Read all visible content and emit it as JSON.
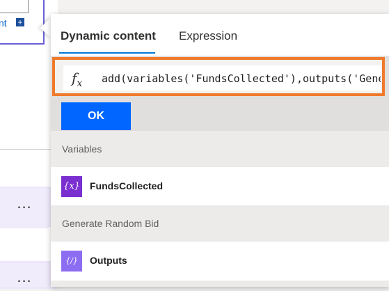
{
  "background": {
    "add_link_text": "nt",
    "plus_icon": "plus-icon",
    "ellipsis_1": "...",
    "ellipsis_2": "..."
  },
  "panel": {
    "tabs": [
      {
        "label": "Dynamic content",
        "active": true
      },
      {
        "label": "Expression",
        "active": false
      }
    ],
    "expression": {
      "fx_label": "f",
      "fx_sub": "x",
      "value": "add(variables('FundsCollected'),outputs('Generate_Random_Bid'))"
    },
    "ok_label": "OK",
    "sections": [
      {
        "header": "Variables",
        "items": [
          {
            "label": "FundsCollected",
            "icon": "variable-icon",
            "icon_text": "{x}"
          }
        ]
      },
      {
        "header": "Generate Random Bid",
        "items": [
          {
            "label": "Outputs",
            "icon": "compose-icon",
            "icon_text": "{/}"
          }
        ]
      }
    ]
  },
  "colors": {
    "accent": "#0078d4",
    "ok_button": "#0066ff",
    "highlight_border": "#f07a2c",
    "variable_icon": "#7a2fd1",
    "compose_icon": "#8c6df2"
  }
}
